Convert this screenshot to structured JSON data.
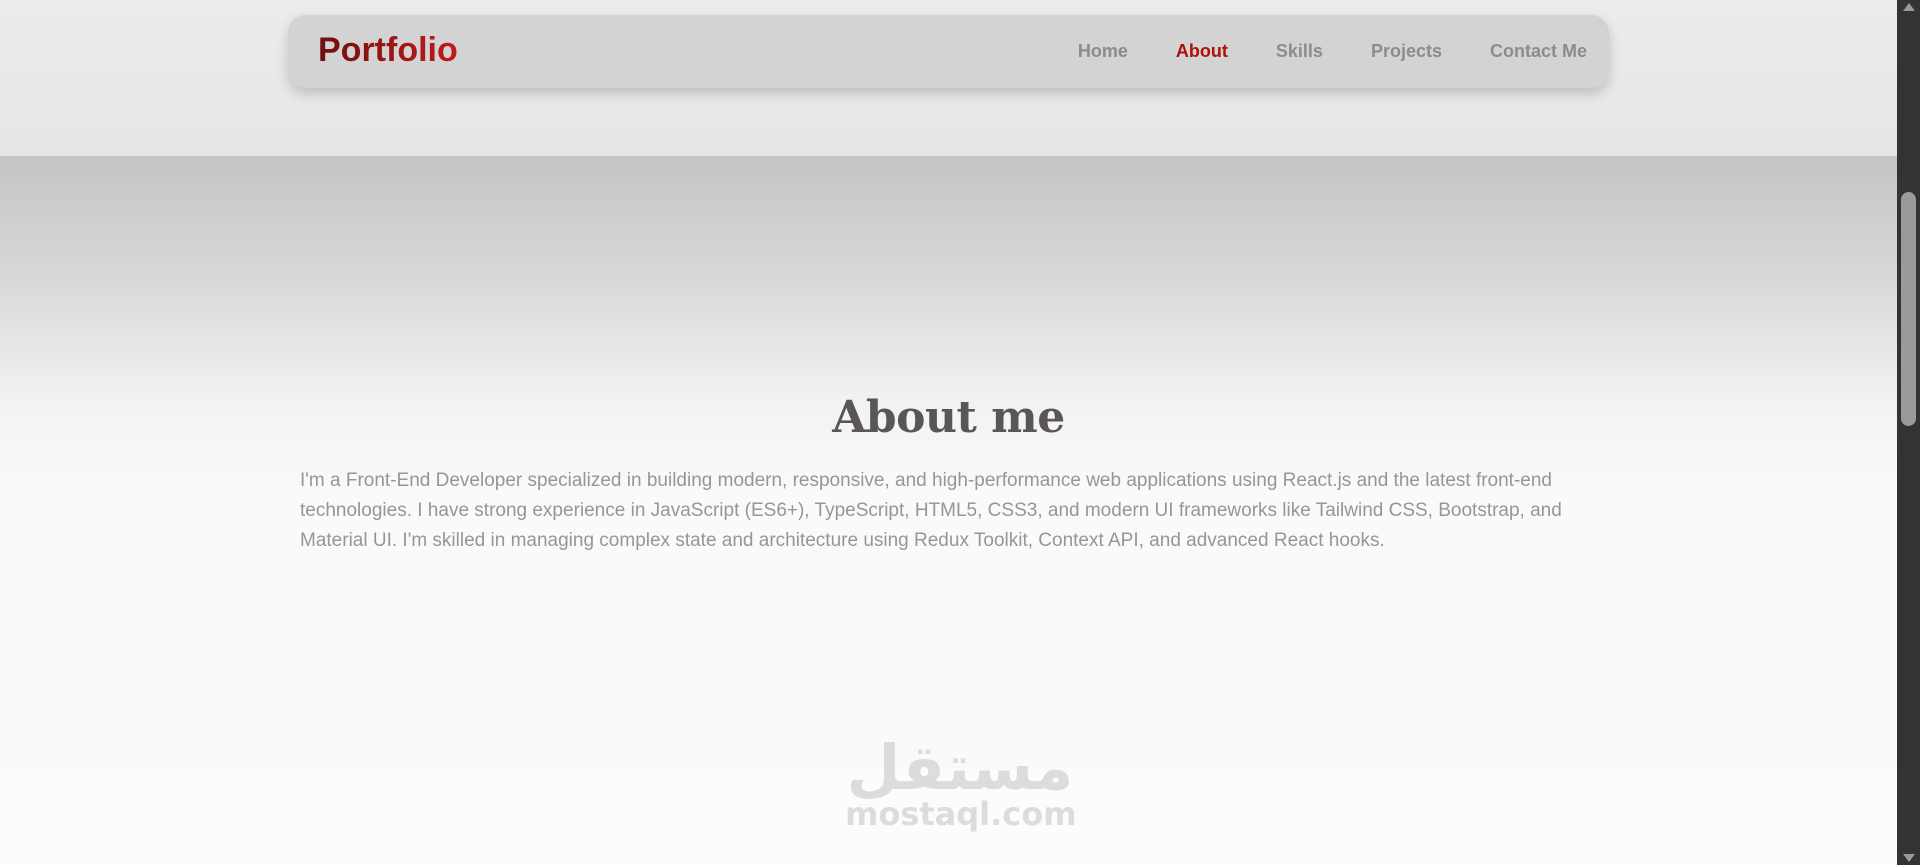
{
  "navbar": {
    "brand": "Portfolio",
    "links": [
      {
        "label": "Home",
        "active": false
      },
      {
        "label": "About",
        "active": true
      },
      {
        "label": "Skills",
        "active": false
      },
      {
        "label": "Projects",
        "active": false
      },
      {
        "label": "Contact Me",
        "active": false
      }
    ]
  },
  "about": {
    "title": "About me",
    "text": "I'm a Front-End Developer specialized in building modern, responsive, and high-performance web applications using React.js and the latest front-end technologies. I have strong experience in JavaScript (ES6+), TypeScript, HTML5, CSS3, and modern UI frameworks like Tailwind CSS, Bootstrap, and Material UI. I'm skilled in managing complex state and architecture using Redux Toolkit, Context API, and advanced React hooks."
  },
  "watermark": {
    "arabic": "مستقل",
    "latin": "mostaql.com"
  },
  "colors": {
    "accent": "#b10e0e",
    "nav_text": "#8c8c8c",
    "navbar_bg": "#d3d3d3"
  }
}
